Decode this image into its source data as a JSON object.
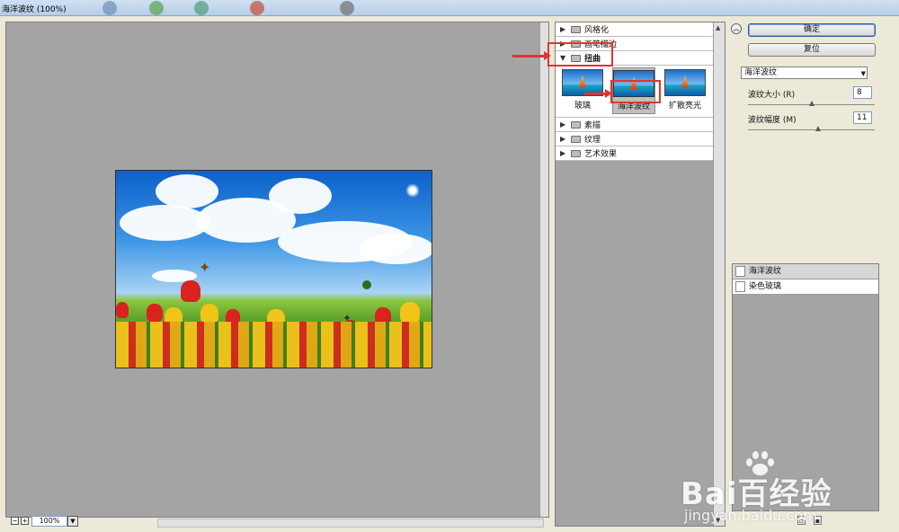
{
  "window": {
    "title": "海洋波纹 (100%)"
  },
  "preview": {
    "zoom_value": "100%",
    "zoom_out_label": "−",
    "zoom_in_label": "+"
  },
  "filter_gallery": {
    "categories": [
      {
        "label": "风格化",
        "expanded": false
      },
      {
        "label": "画笔描边",
        "expanded": false
      },
      {
        "label": "扭曲",
        "expanded": true
      },
      {
        "label": "素描",
        "expanded": false
      },
      {
        "label": "纹理",
        "expanded": false
      },
      {
        "label": "艺术效果",
        "expanded": false
      }
    ],
    "distort_filters": [
      {
        "label": "玻璃"
      },
      {
        "label": "海洋波纹",
        "selected": true
      },
      {
        "label": "扩散亮光"
      }
    ]
  },
  "buttons": {
    "ok_label": "确定",
    "reset_label": "复位"
  },
  "filter_select": {
    "value": "海洋波纹"
  },
  "params": [
    {
      "label": "波纹大小 (R)",
      "value": "8",
      "level": 0.5
    },
    {
      "label": "波纹幅度 (M)",
      "value": "11",
      "level": 0.55
    }
  ],
  "effect_layers": [
    {
      "label": "海洋波纹",
      "active": true
    },
    {
      "label": "染色玻璃",
      "active": false
    }
  ],
  "watermark": {
    "brand": "Bai百经验",
    "url": "jingyan.baidu.com"
  },
  "colors": {
    "annotation_red": "#e0352e",
    "panel_gray": "#a4a4a4",
    "dialog_bg": "#ece9d8"
  },
  "icons": {
    "collapse": "double-chevron-up-icon",
    "new_layer": "new-layer-icon",
    "delete_layer": "trash-icon",
    "expand": "triangle-right-icon",
    "expanded": "triangle-down-icon",
    "folder": "folder-icon"
  }
}
